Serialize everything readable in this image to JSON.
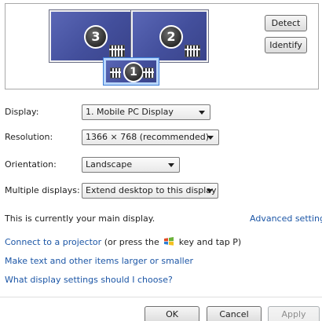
{
  "monitors": [
    {
      "number": "3",
      "selected": false
    },
    {
      "number": "2",
      "selected": false
    },
    {
      "number": "1",
      "selected": true
    }
  ],
  "buttons": {
    "detect": "Detect",
    "identify": "Identify",
    "ok": "OK",
    "cancel": "Cancel",
    "apply": "Apply"
  },
  "form": {
    "display": {
      "label": "Display:",
      "value": "1. Mobile PC Display"
    },
    "resolution": {
      "label": "Resolution:",
      "value": "1366 × 768 (recommended)"
    },
    "orientation": {
      "label": "Orientation:",
      "value": "Landscape"
    },
    "multiple_displays": {
      "label": "Multiple displays:",
      "value": "Extend desktop to this display"
    }
  },
  "status": {
    "main_display": "This is currently your main display.",
    "advanced_settings": "Advanced settings"
  },
  "links": {
    "projector_link": "Connect to a projector",
    "projector_text_before": "(or press the",
    "projector_text_after": "key and tap P)",
    "text_size": "Make text and other items larger or smaller",
    "what_settings": "What display settings should I choose?"
  },
  "colors": {
    "monitor_fill": "#434f9c",
    "link": "#1c56a6",
    "selected_outline": "#3e7ed8"
  },
  "icons": {
    "windows_key": "windows-logo-icon"
  }
}
